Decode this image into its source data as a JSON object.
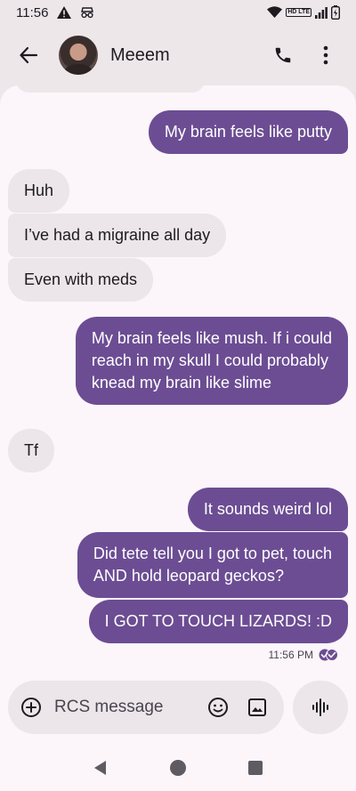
{
  "status_bar": {
    "time": "11:56",
    "network_badge": "HD LTE"
  },
  "header": {
    "contact_name": "Meeem"
  },
  "messages": [
    {
      "direction": "outgoing",
      "text": "My brain feels like putty"
    },
    {
      "direction": "incoming",
      "text": "Huh"
    },
    {
      "direction": "incoming",
      "text": "I’ve had a migraine all day"
    },
    {
      "direction": "incoming",
      "text": "Even with meds"
    },
    {
      "direction": "outgoing",
      "lines": [
        "My brain feels like mush. If i could",
        "reach in my skull I could probably",
        "knead my brain like slime"
      ]
    },
    {
      "direction": "incoming",
      "text": "Tf"
    },
    {
      "direction": "outgoing",
      "text": "It sounds weird lol"
    },
    {
      "direction": "outgoing",
      "lines": [
        "Did tete tell you I got to pet, touch",
        "AND hold leopard geckos?"
      ]
    },
    {
      "direction": "outgoing",
      "text": "I GOT TO TOUCH LIZARDS! :D"
    }
  ],
  "last_timestamp": "11:56 PM",
  "compose": {
    "placeholder": "RCS message"
  },
  "icons": {
    "back": "arrow-left-icon",
    "call": "phone-icon",
    "more": "more-vertical-icon",
    "add": "plus-circle-icon",
    "emoji": "emoji-icon",
    "gallery": "image-icon",
    "voice": "voice-waveform-icon",
    "read": "read-receipt-icon"
  },
  "colors": {
    "outgoing_bubble": "#6c4d93",
    "incoming_bubble": "#ece6ea",
    "background": "#fcf6fb",
    "app_bar": "#ede7ea"
  }
}
